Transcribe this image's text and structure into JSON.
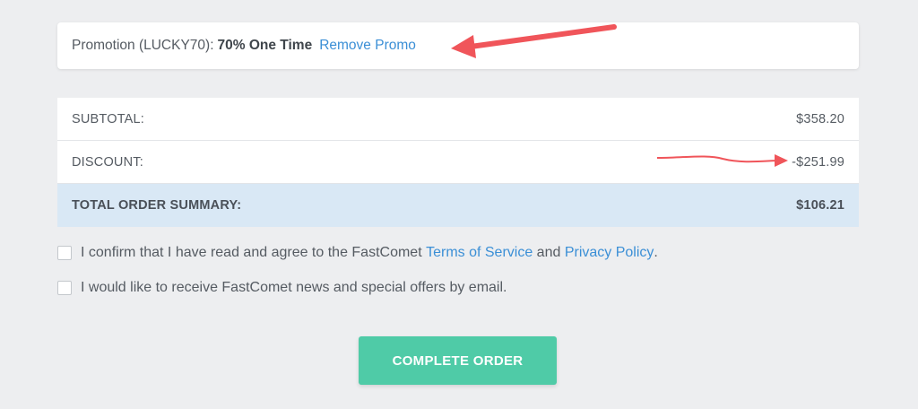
{
  "promo": {
    "label": "Promotion (LUCKY70):",
    "detail": "70% One Time",
    "remove_link": "Remove Promo"
  },
  "summary": {
    "rows": [
      {
        "label": "SUBTOTAL:",
        "value": "$358.20"
      },
      {
        "label": "DISCOUNT:",
        "value": "-$251.99"
      }
    ],
    "total": {
      "label": "TOTAL ORDER SUMMARY:",
      "value": "$106.21"
    }
  },
  "agreements": {
    "terms": {
      "prefix": "I confirm that I have read and agree to the FastComet ",
      "terms_link": "Terms of Service",
      "and": " and ",
      "privacy_link": "Privacy Policy",
      "suffix": "."
    },
    "newsletter": "I would like to receive FastComet news and special offers by email."
  },
  "button": {
    "label": "COMPLETE ORDER"
  },
  "colors": {
    "accent_green": "#4fcba7",
    "link_blue": "#3b8fd6",
    "annotation_red": "#f0555a",
    "total_row_bg": "#d9e8f5"
  }
}
